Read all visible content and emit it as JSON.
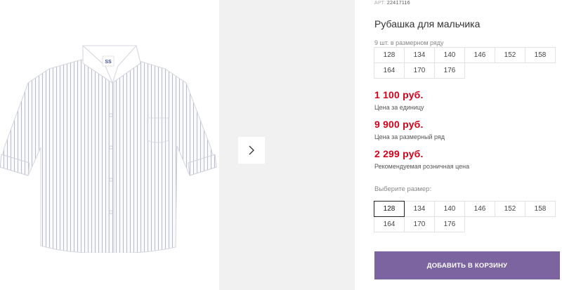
{
  "product": {
    "article_prefix": "АРТ.",
    "article_number": "22417116",
    "title": "Рубашка для мальчика",
    "row_note": "9 шт. в размерном ряду",
    "row_sizes": [
      "128",
      "134",
      "140",
      "146",
      "152",
      "158",
      "164",
      "170",
      "176"
    ]
  },
  "prices": [
    {
      "amount": "1 100 руб.",
      "label": "Цена за единицу"
    },
    {
      "amount": "9 900 руб.",
      "label": "Цена за размерный ряд"
    },
    {
      "amount": "2 299 руб.",
      "label": "Рекомендуемая розничная цена"
    }
  ],
  "size_picker": {
    "label": "Выберите размер:",
    "sizes": [
      "128",
      "134",
      "140",
      "146",
      "152",
      "158",
      "164",
      "170",
      "176"
    ],
    "selected": "128"
  },
  "cart_button_label": "ДОБАВИТЬ В КОРЗИНУ",
  "gallery": {
    "next_icon": "chevron-right-icon",
    "logo_text": "SS"
  },
  "colors": {
    "price": "#d0021b",
    "button": "#7b64a0",
    "panel": "#f1f1f1"
  }
}
